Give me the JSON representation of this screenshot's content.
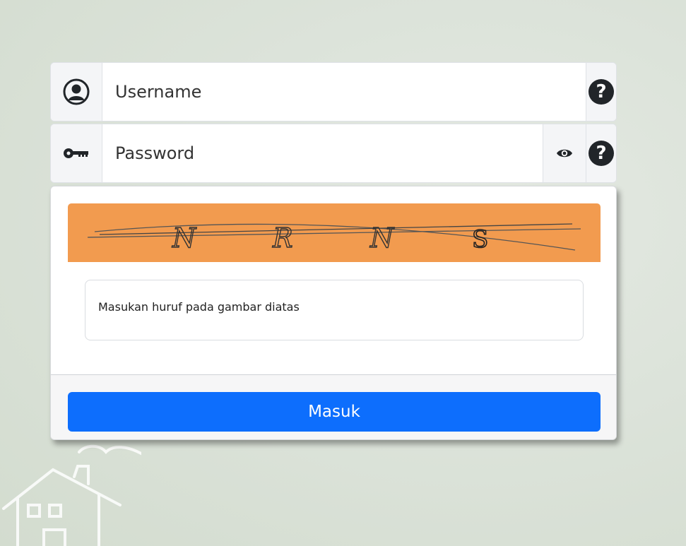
{
  "login": {
    "username_placeholder": "Username",
    "password_placeholder": "Password",
    "username_help": "?",
    "password_help": "?",
    "captcha_letters": [
      "N",
      "R",
      "N",
      "S"
    ],
    "captcha_instruction": "Masukan huruf pada gambar diatas",
    "submit_label": "Masuk"
  },
  "colors": {
    "accent": "#0d6efd",
    "captcha_background": "#f29b4f",
    "icon_dark": "#212529"
  },
  "icons": {
    "username": "user-circle-icon",
    "password": "key-icon",
    "show_password": "eye-icon",
    "help": "question-circle-icon"
  }
}
